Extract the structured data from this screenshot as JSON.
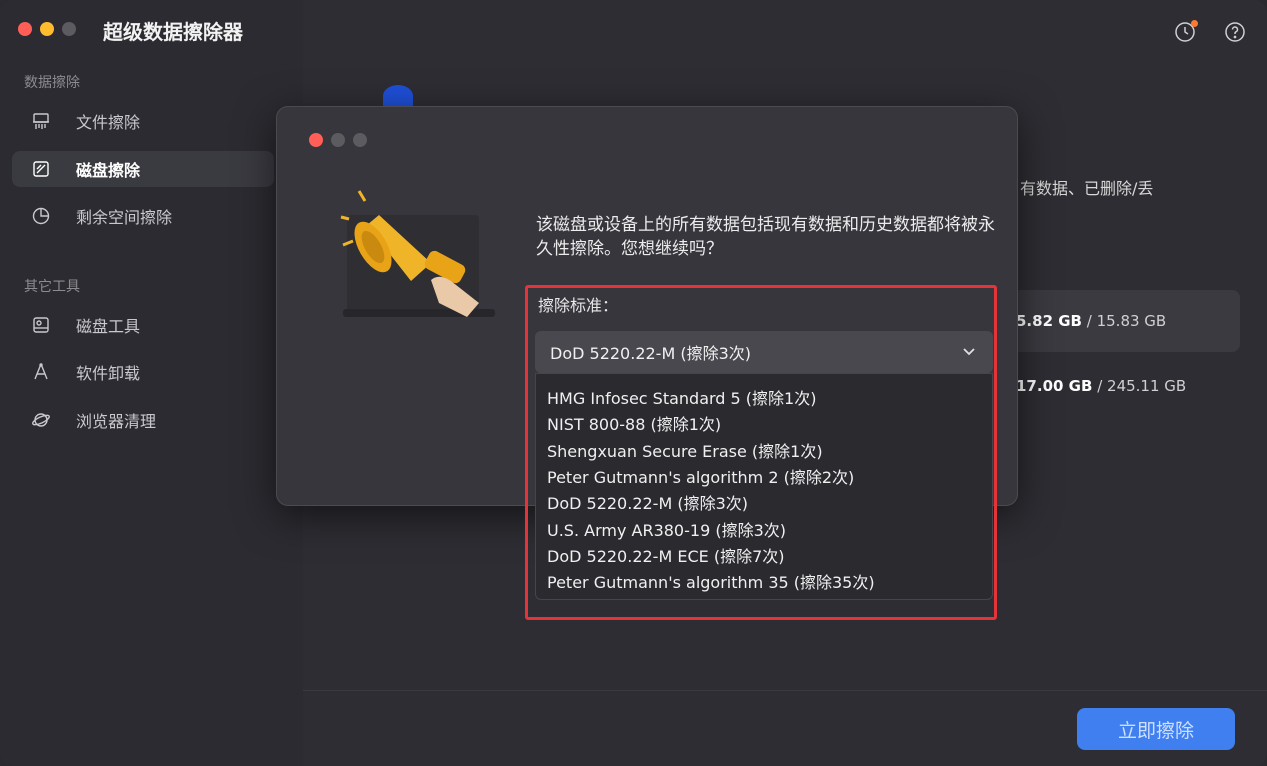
{
  "app": {
    "title": "超级数据擦除器"
  },
  "sidebar": {
    "section1": "数据擦除",
    "items1": [
      {
        "label": "文件擦除",
        "icon": "shredder-icon"
      },
      {
        "label": "磁盘擦除",
        "icon": "disk-erase-icon",
        "active": true
      },
      {
        "label": "剩余空间擦除",
        "icon": "pie-chart-icon"
      }
    ],
    "section2": "其它工具",
    "items2": [
      {
        "label": "磁盘工具",
        "icon": "disk-tool-icon"
      },
      {
        "label": "软件卸载",
        "icon": "uninstall-icon"
      },
      {
        "label": "浏览器清理",
        "icon": "browser-clean-icon"
      }
    ]
  },
  "main": {
    "bg_text": "有数据、已删除/丢",
    "disks": [
      {
        "used": "5.82 GB",
        "total": "/ 15.83 GB"
      },
      {
        "used": "17.00 GB",
        "total": "/ 245.11 GB"
      }
    ],
    "erase_button": "立即擦除"
  },
  "dialog": {
    "message": "该磁盘或设备上的所有数据包括现有数据和历史数据都将被永久性擦除。您想继续吗？",
    "standard_label": "擦除标准：",
    "selected": "DoD 5220.22-M (擦除3次)",
    "options": [
      "HMG Infosec Standard 5 (擦除1次)",
      "NIST 800-88 (擦除1次)",
      "Shengxuan Secure Erase (擦除1次)",
      "Peter Gutmann's algorithm 2 (擦除2次)",
      "DoD 5220.22-M (擦除3次)",
      "U.S. Army AR380-19 (擦除3次)",
      "DoD 5220.22-M ECE (擦除7次)",
      "Peter Gutmann's algorithm 35 (擦除35次)"
    ]
  },
  "colors": {
    "accent": "#3f7ff0",
    "highlight_border": "#e5333a"
  }
}
